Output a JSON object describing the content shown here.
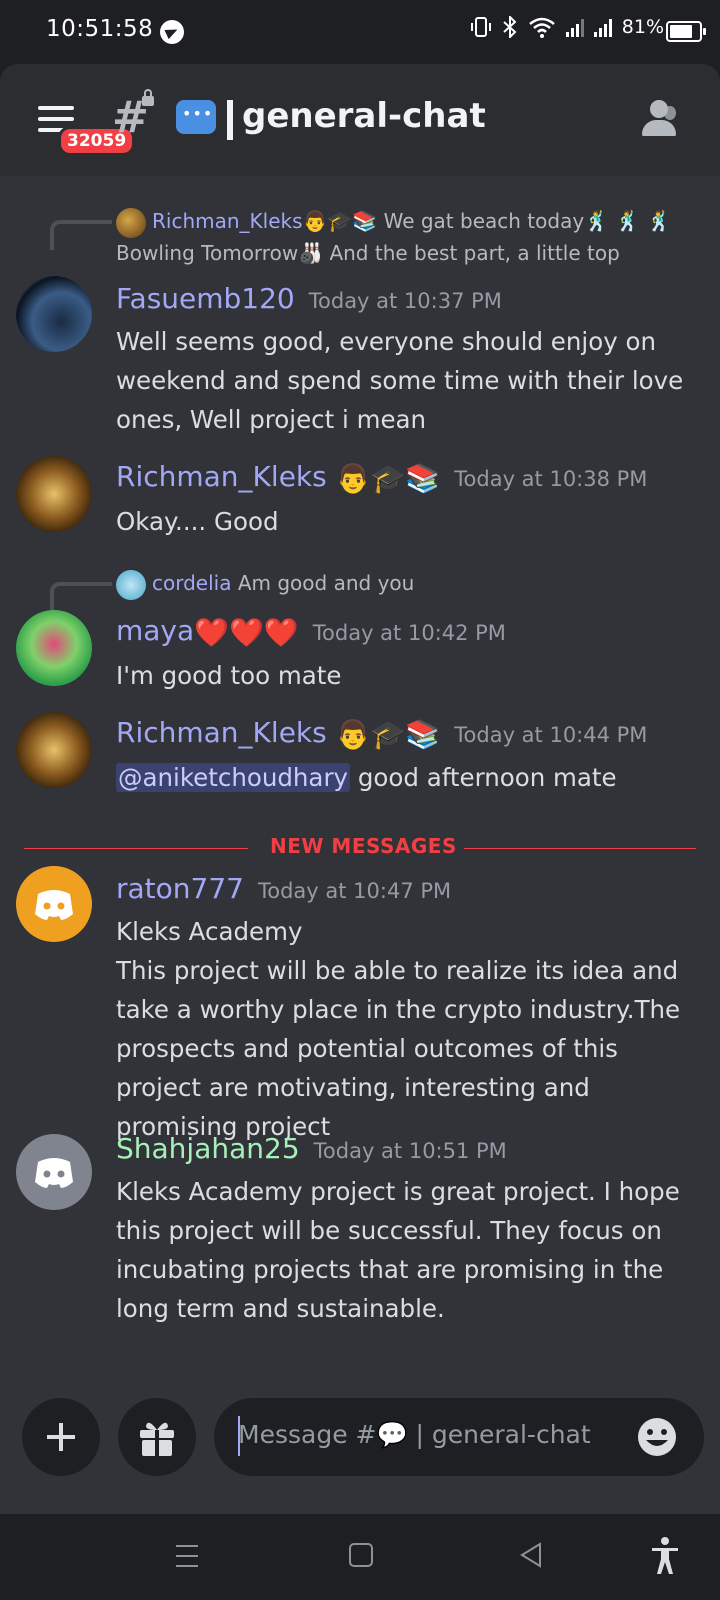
{
  "status_bar": {
    "time": "10:51:58",
    "battery": "81%"
  },
  "header": {
    "badge_count": "32059",
    "channel_name": "general-chat",
    "channel_emoji": "speech-balloon-icon"
  },
  "messages": [
    {
      "reply": {
        "user": "Richman_Kleks👨🎓📚",
        "text": "We gat beach today🕺 🕺 🕺 Bowling Tomorrow🎳 And the best part, a little top"
      },
      "user": "Fasuemb120",
      "user_color": "#a2a8f5",
      "time": "Today at 10:37 PM",
      "text": "Well seems good, everyone should enjoy on weekend and spend some time with their love ones, Well project i mean"
    },
    {
      "user": "Richman_Kleks",
      "user_color": "#a2a8f5",
      "time": "Today at 10:38 PM",
      "text": "Okay.... Good"
    },
    {
      "reply": {
        "user": "cordelia",
        "text": "Am good and you"
      },
      "user": "maya",
      "user_color": "#a2a8f5",
      "time": "Today at 10:42 PM",
      "text": "I'm good too mate"
    },
    {
      "user": "Richman_Kleks",
      "user_color": "#a2a8f5",
      "time": "Today at 10:44 PM",
      "mention": "@aniketchoudhary",
      "text": " good afternoon mate"
    },
    {
      "user": "raton777",
      "user_color": "#a2a8f5",
      "time": "Today at 10:47 PM",
      "text": "Kleks Academy",
      "text2": "This project will be able to realize its idea and take a worthy place in the crypto industry.The prospects and potential outcomes of this project are motivating, interesting and promising project"
    },
    {
      "user": "Shahjahan25",
      "user_color": "#a6f0b9",
      "time": "Today at 10:51 PM",
      "text": "Kleks Academy project is great project. I hope this project will be successful. They focus on incubating projects that are promising in the long term and sustainable."
    }
  ],
  "divider": {
    "label": "NEW MESSAGES"
  },
  "composer": {
    "placeholder": "Message #💬 | general-chat"
  },
  "colors": {
    "accent": "#5865f2",
    "danger": "#f23f43",
    "discord_orange": "#f0a020",
    "discord_grey": "#80848e"
  }
}
